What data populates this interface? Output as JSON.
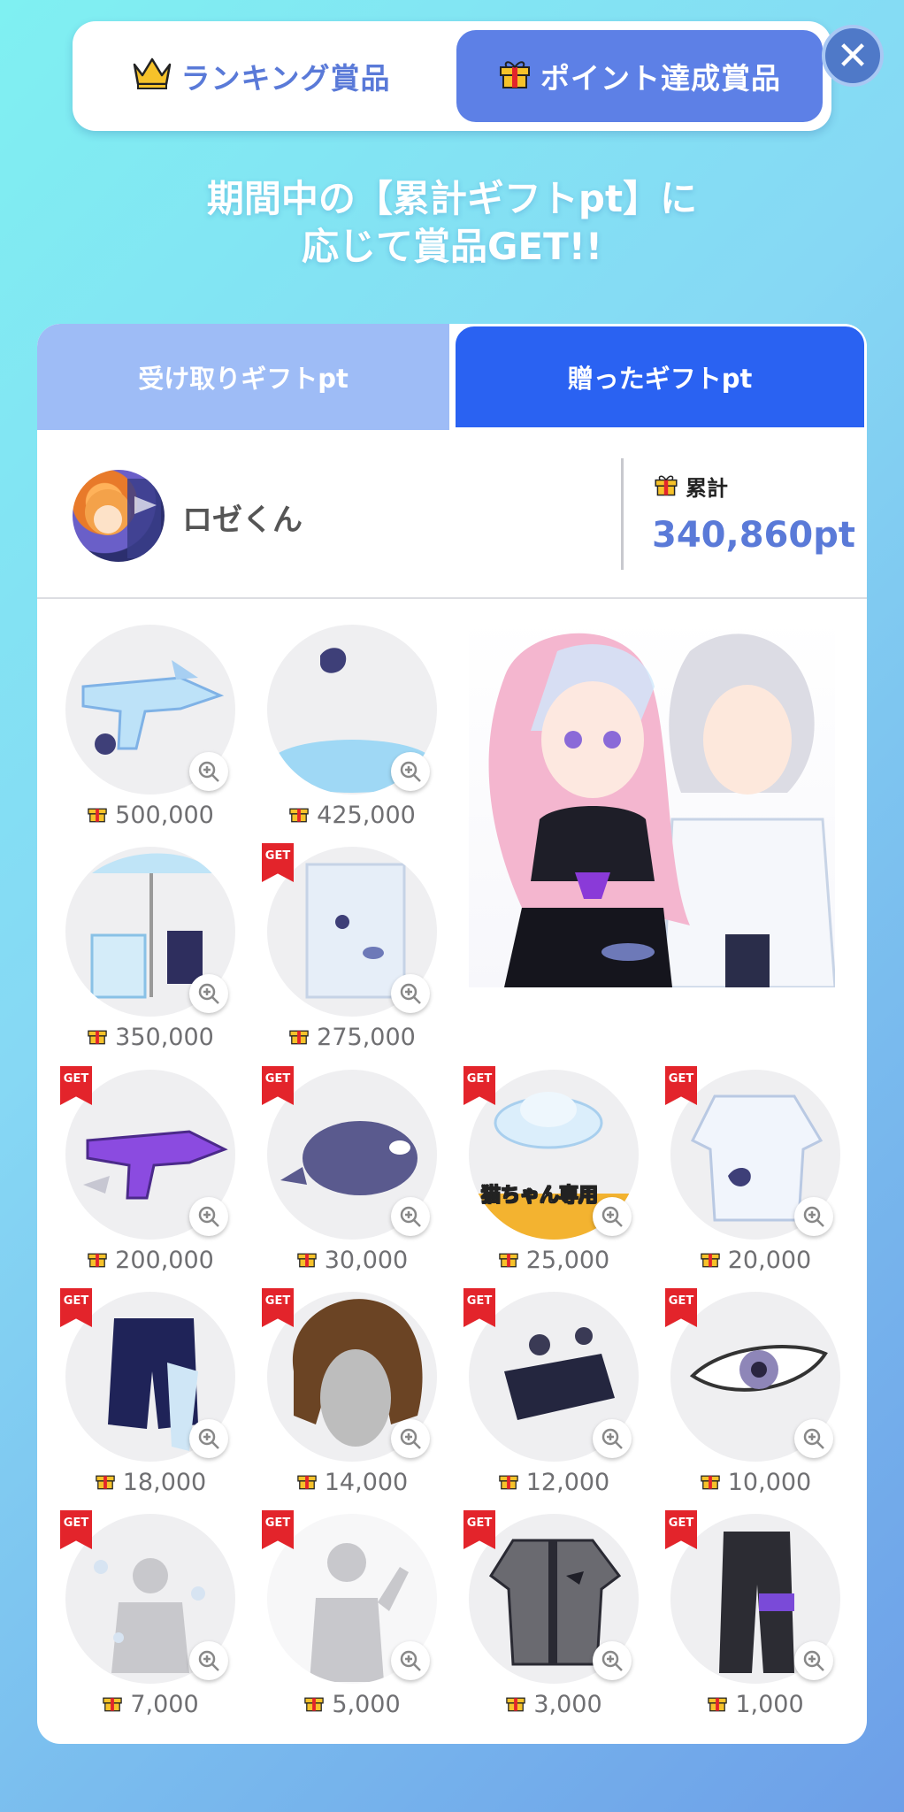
{
  "top_tabs": {
    "ranking_label": "ランキング賞品",
    "points_label": "ポイント達成賞品"
  },
  "close_label": "✕",
  "headline": {
    "line1": "期間中の【累計ギフトpt】に",
    "line2": "応じて賞品GET!!"
  },
  "sub_tabs": {
    "received_label": "受け取りギフトpt",
    "sent_label": "贈ったギフトpt"
  },
  "profile": {
    "name": "ロゼくん",
    "total_label": "累計",
    "total_value": "340,860pt"
  },
  "get_label": "GET",
  "exclusive_tag": "猫ちゃん専用",
  "prizes": [
    {
      "price": "500,000",
      "got": false,
      "icon": "water-gun-icon"
    },
    {
      "price": "425,000",
      "got": false,
      "icon": "orca-splash-icon"
    },
    {
      "price": "350,000",
      "got": false,
      "icon": "beach-chair-icon"
    },
    {
      "price": "275,000",
      "got": true,
      "icon": "frame-icon"
    },
    {
      "price": "200,000",
      "got": true,
      "icon": "purple-water-gun-icon"
    },
    {
      "price": "30,000",
      "got": true,
      "icon": "orca-float-icon"
    },
    {
      "price": "25,000",
      "got": true,
      "icon": "cat-hat-icon"
    },
    {
      "price": "20,000",
      "got": true,
      "icon": "hoodie-icon"
    },
    {
      "price": "18,000",
      "got": true,
      "icon": "shorts-icon"
    },
    {
      "price": "14,000",
      "got": true,
      "icon": "hair-icon"
    },
    {
      "price": "12,000",
      "got": true,
      "icon": "float-mat-icon"
    },
    {
      "price": "10,000",
      "got": true,
      "icon": "eye-icon"
    },
    {
      "price": "7,000",
      "got": true,
      "icon": "effect-icon"
    },
    {
      "price": "5,000",
      "got": true,
      "icon": "pose-icon"
    },
    {
      "price": "3,000",
      "got": true,
      "icon": "shirt-icon"
    },
    {
      "price": "1,000",
      "got": true,
      "icon": "pants-icon"
    }
  ],
  "colors": {
    "accent_blue": "#5a7ad8",
    "active_tab": "#2a62f2",
    "get_red": "#e3242b"
  }
}
